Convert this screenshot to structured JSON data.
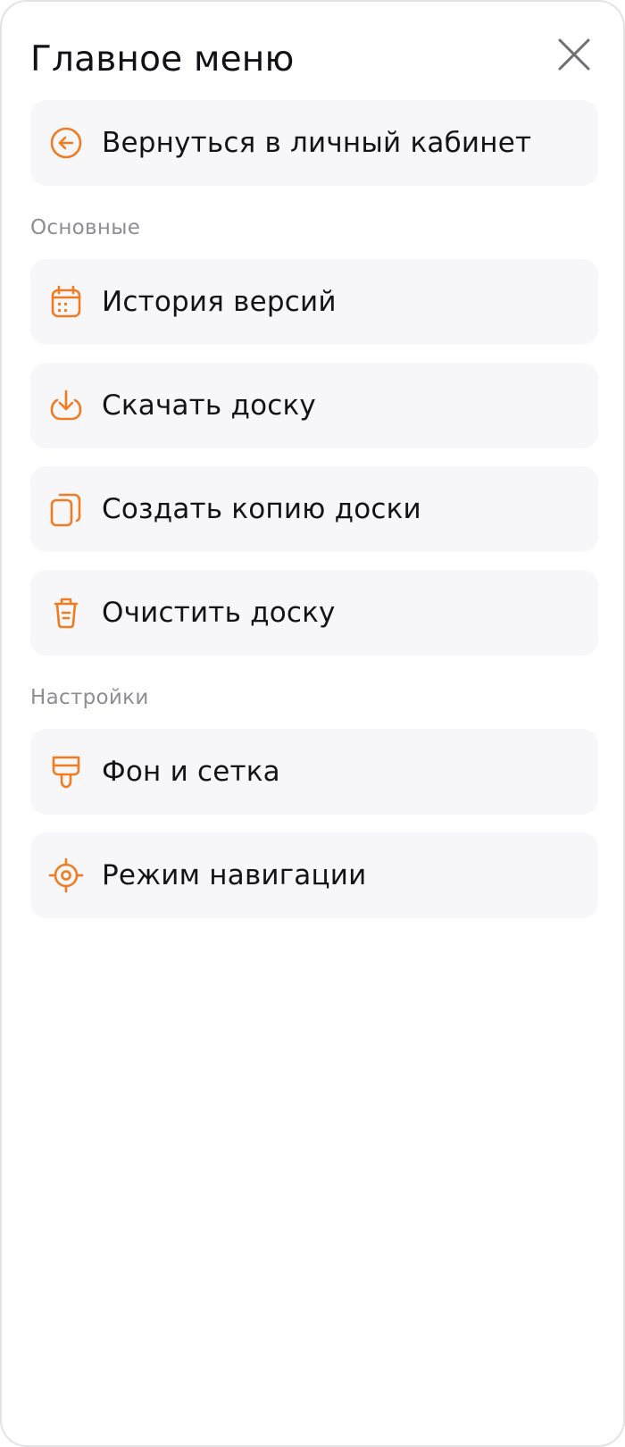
{
  "header": {
    "title": "Главное меню",
    "close_icon": "close-icon"
  },
  "back_item": {
    "label": "Вернуться в личный кабинет",
    "icon": "arrow-left-circle-icon"
  },
  "sections": [
    {
      "title": "Основные",
      "items": [
        {
          "label": "История версий",
          "icon": "calendar-icon"
        },
        {
          "label": "Скачать доску",
          "icon": "download-icon"
        },
        {
          "label": "Создать копию доски",
          "icon": "copy-icon"
        },
        {
          "label": "Очистить доску",
          "icon": "trash-icon"
        }
      ]
    },
    {
      "title": "Настройки",
      "items": [
        {
          "label": "Фон и сетка",
          "icon": "paint-brush-icon"
        },
        {
          "label": "Режим навигации",
          "icon": "target-icon"
        }
      ]
    }
  ],
  "colors": {
    "accent": "#f07c22",
    "item_background": "#f7f7f9",
    "section_label": "#8d8d93",
    "text": "#141418",
    "close_icon": "#6f6f75"
  }
}
